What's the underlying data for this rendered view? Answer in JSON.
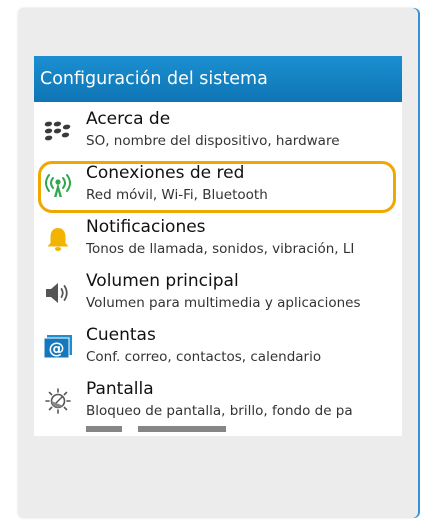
{
  "header": {
    "title": "Configuración del sistema"
  },
  "settings": [
    {
      "title": "Acerca de",
      "subtitle": "SO, nombre del dispositivo, hardware",
      "icon": "blackberry-logo-icon"
    },
    {
      "title": "Conexiones de red",
      "subtitle": "Red móvil, Wi-Fi, Bluetooth",
      "icon": "antenna-icon"
    },
    {
      "title": "Notificaciones",
      "subtitle": "Tonos de llamada, sonidos, vibración, LI",
      "icon": "bell-icon"
    },
    {
      "title": "Volumen principal",
      "subtitle": "Volumen para multimedia y aplicaciones",
      "icon": "speaker-icon"
    },
    {
      "title": "Cuentas",
      "subtitle": "Conf. correo, contactos, calendario",
      "icon": "at-sign-icon"
    },
    {
      "title": "Pantalla",
      "subtitle": "Bloqueo de pantalla, brillo, fondo de pa",
      "icon": "brightness-icon"
    }
  ],
  "colors": {
    "title_bar": "#0f75b5",
    "highlight": "#f0a800",
    "antenna": "#2fa84f",
    "bell": "#f2b400"
  }
}
